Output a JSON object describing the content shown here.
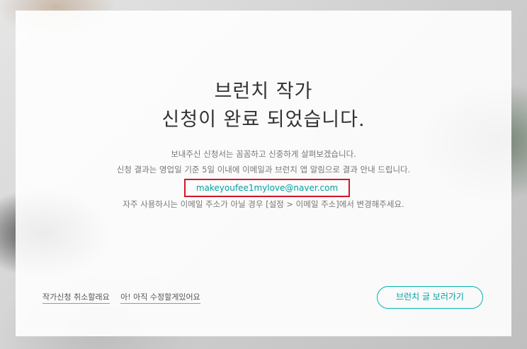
{
  "title": {
    "line1": "브런치 작가",
    "line2": "신청이 완료 되었습니다."
  },
  "description": {
    "line1": "보내주신 신청서는 꼼꼼하고 신중하게 살펴보겠습니다.",
    "line2": "신청 결과는 영업일 기준 5일 이내에 이메일과 브런치 앱 알림으로 결과 안내 드립니다."
  },
  "email": "makeyoufee1mylove@naver.com",
  "note": "자주 사용하시는 이메일 주소가 아닐 경우 [설정 > 이메일 주소]에서 변경해주세요.",
  "links": {
    "cancel": "작가신청 취소할래요",
    "edit": "아! 아직 수정할게있어요"
  },
  "cta": "브런치 글 보러가기",
  "colors": {
    "accent": "#00a2a0",
    "highlight_border": "#d0162a"
  }
}
